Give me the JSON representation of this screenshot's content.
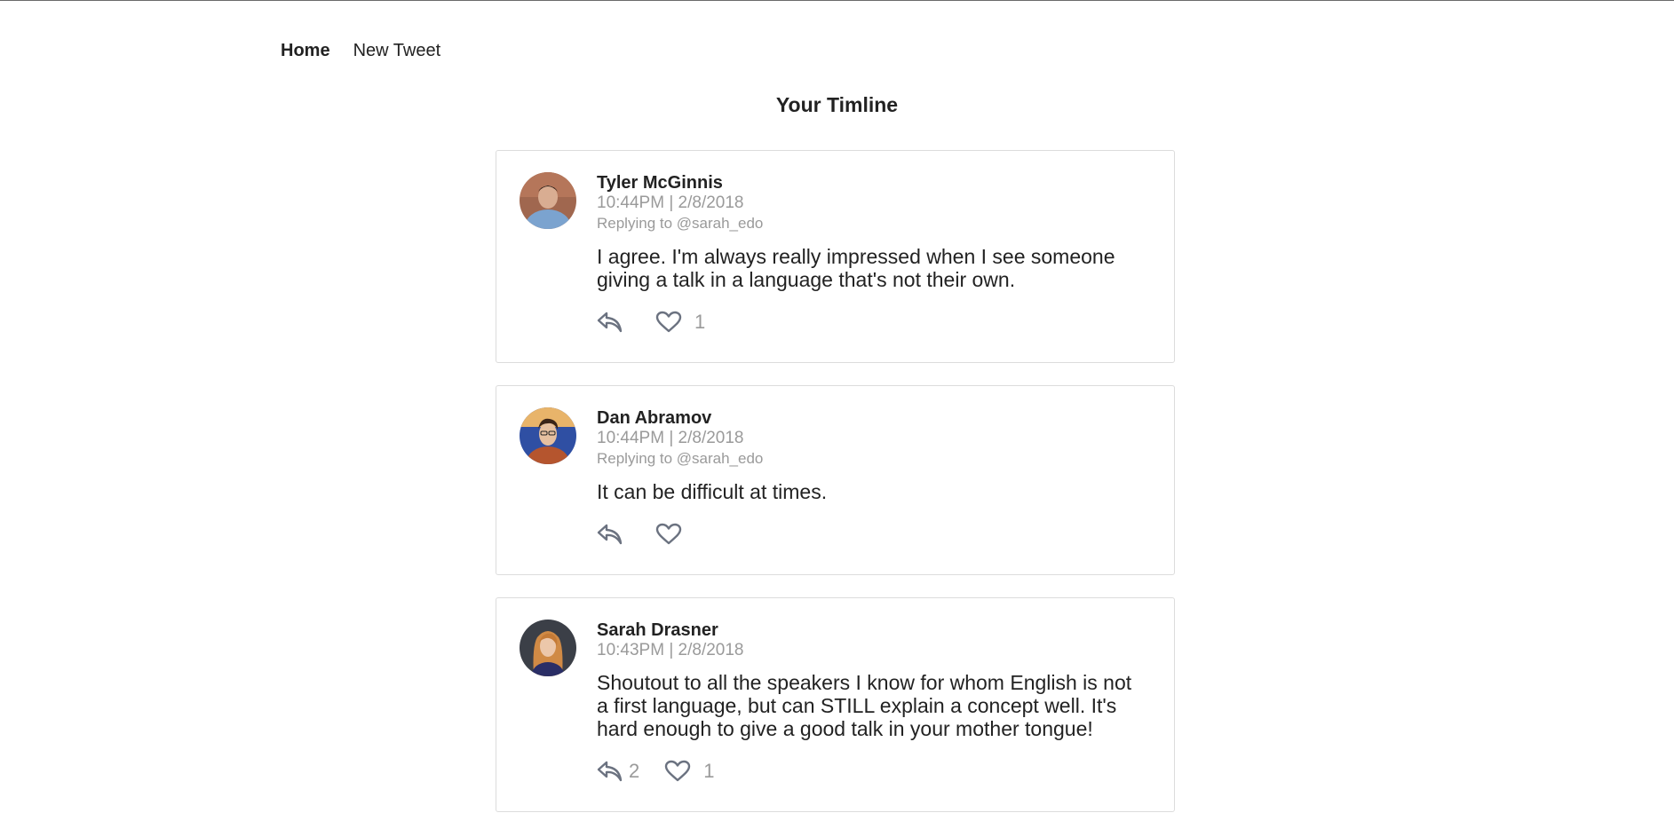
{
  "nav": {
    "home": "Home",
    "new_tweet": "New Tweet"
  },
  "page_title": "Your Timline",
  "tweets": [
    {
      "author": "Tyler McGinnis",
      "timestamp": "10:44PM | 2/8/2018",
      "replying_to": "Replying to @sarah_edo",
      "text": "I agree. I'm always really impressed when I see someone giving a talk in a language that's not their own.",
      "replies": "",
      "likes": "1",
      "avatar_icon": "avatar-tyler"
    },
    {
      "author": "Dan Abramov",
      "timestamp": "10:44PM | 2/8/2018",
      "replying_to": "Replying to @sarah_edo",
      "text": "It can be difficult at times.",
      "replies": "",
      "likes": "",
      "avatar_icon": "avatar-dan"
    },
    {
      "author": "Sarah Drasner",
      "timestamp": "10:43PM | 2/8/2018",
      "replying_to": "",
      "text": "Shoutout to all the speakers I know for whom English is not a first language, but can STILL explain a concept well. It's hard enough to give a good talk in your mother tongue!",
      "replies": "2",
      "likes": "1",
      "avatar_icon": "avatar-sarah"
    }
  ],
  "colors": {
    "text": "#222222",
    "muted": "#9a9a9a",
    "icon": "#6b7280",
    "border": "#dcdcdc"
  }
}
